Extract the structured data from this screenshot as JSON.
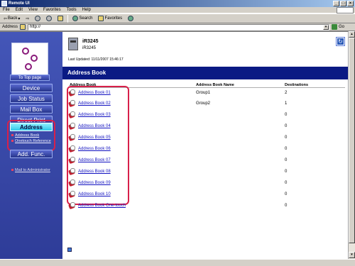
{
  "window": {
    "title": "Remote UI"
  },
  "menu": [
    "File",
    "Edit",
    "View",
    "Favorites",
    "Tools",
    "Help"
  ],
  "toolbar": {
    "back": "Back",
    "search": "Search",
    "favorites": "Favorites"
  },
  "address_bar": {
    "label": "Address",
    "url": "http://",
    "go": "Go"
  },
  "nav": {
    "to_top": "To Top page",
    "buttons": [
      "Device",
      "Job Status",
      "Mail Box",
      "Direct Print"
    ],
    "active": "Address",
    "sub_items": [
      "Address Book",
      "Onetouch Reference"
    ],
    "add_func": "Add. Func.",
    "mail_admin": "Mail to Administrator"
  },
  "device": {
    "name": "iR3245",
    "model": "iR3245"
  },
  "last_updated": "Last Updated: 11/11/2007 15:46:17",
  "page_title": "Address Book",
  "table": {
    "headers": [
      "Address Book",
      "Address Book Name",
      "Destinations"
    ],
    "rows": [
      {
        "label": "Address Book 01",
        "name": "Group1",
        "dest": "2"
      },
      {
        "label": "Address Book 02",
        "name": "Group2",
        "dest": "1"
      },
      {
        "label": "Address Book 03",
        "name": "",
        "dest": "0"
      },
      {
        "label": "Address Book 04",
        "name": "",
        "dest": "0"
      },
      {
        "label": "Address Book 05",
        "name": "",
        "dest": "0"
      },
      {
        "label": "Address Book 06",
        "name": "",
        "dest": "0"
      },
      {
        "label": "Address Book 07",
        "name": "",
        "dest": "0"
      },
      {
        "label": "Address Book 08",
        "name": "",
        "dest": "0"
      },
      {
        "label": "Address Book 09",
        "name": "",
        "dest": "0"
      },
      {
        "label": "Address Book 10",
        "name": "",
        "dest": "0"
      },
      {
        "label": "Address Book One-touch",
        "name": "",
        "dest": "0"
      }
    ]
  },
  "colors": {
    "banner": "#0a1a84",
    "nav_bg": "#3b4aa8",
    "active_nav": "#30c8e8",
    "highlight": "#d8204a",
    "link": "#1010c0"
  }
}
